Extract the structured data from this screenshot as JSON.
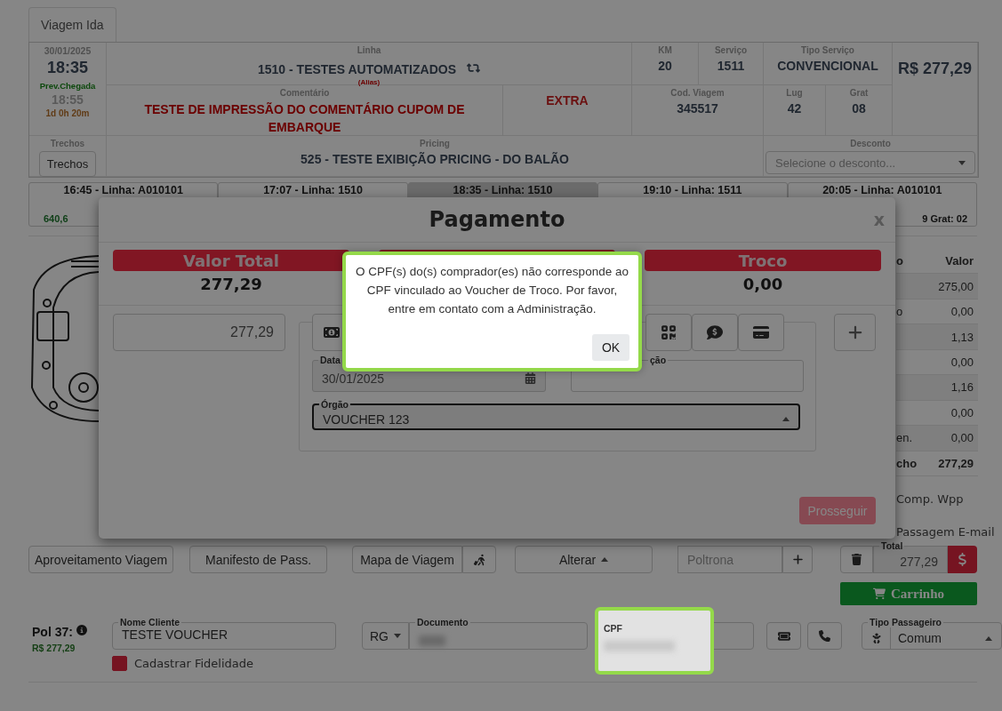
{
  "tabs": [
    {
      "label": "Viagem Ida",
      "selected": true
    }
  ],
  "trip": {
    "date": "30/01/2025",
    "departure": "18:35",
    "arrival_label": "Prev.Chegada",
    "arrival": "18:55",
    "duration": "1d 0h 20m",
    "line": {
      "label": "Linha",
      "value": "1510 - TESTES AUTOMATIZADOS",
      "alias": "(Alias)"
    },
    "km": {
      "label": "KM",
      "value": "20"
    },
    "service": {
      "label": "Serviço",
      "value": "1511"
    },
    "service_type": {
      "label": "Tipo Serviço",
      "value": "CONVENCIONAL"
    },
    "price": "R$ 277,29",
    "comment": {
      "label": "Comentário",
      "value": "TESTE DE IMPRESSÃO DO COMENTÁRIO CUPOM DE EMBARQUE"
    },
    "extra": "EXTRA",
    "trip_code": {
      "label": "Cod. Viagem",
      "value": "345517"
    },
    "seats": {
      "label": "Lug",
      "value": "42"
    },
    "free": {
      "label": "Grat",
      "value": "08"
    },
    "segments": {
      "label": "Trechos",
      "button": "Trechos"
    },
    "pricing": {
      "label": "Pricing",
      "value": "525 - TESTE EXIBIÇÃO PRICING - DO BALÃO"
    },
    "discount": {
      "label": "Desconto",
      "placeholder": "Selecione o desconto..."
    }
  },
  "schedule": [
    {
      "title": "16:45 - Linha: A010101",
      "detail": "640,6",
      "selected": false
    },
    {
      "title": "17:07 - Linha: 1510",
      "selected": false
    },
    {
      "title": "18:35 - Linha: 1510",
      "selected": true
    },
    {
      "title": "19:10 - Linha: 1511",
      "selected": false
    },
    {
      "title": "20:05 - Linha: A010101",
      "detail": "9 Grat: 02",
      "selected": false
    }
  ],
  "fare_table": {
    "header": [
      "o",
      "Valor"
    ],
    "rows": [
      {
        "kind": "line",
        "value": "275,00"
      },
      {
        "kind": "line",
        "label": "o",
        "value": "0,00"
      },
      {
        "kind": "line",
        "value": "1,13"
      },
      {
        "kind": "line",
        "value": "0,00"
      },
      {
        "kind": "line",
        "value": "1,16"
      },
      {
        "kind": "line",
        "value": "0,00"
      },
      {
        "kind": "line",
        "label": "en.",
        "value": "0,00"
      },
      {
        "kind": "total",
        "label": "cho",
        "value": "277,29"
      }
    ]
  },
  "share_options": [
    "Comp. Wpp",
    "Passagem E-mail"
  ],
  "actions": {
    "reuse": "Aproveitamento Viagem",
    "manifest": "Manifesto de Pass.",
    "map": "Mapa de Viagem",
    "change": "Alterar",
    "seat_placeholder": "Poltrona",
    "total_label": "Total",
    "total": "277,29",
    "cart": "Carrinho"
  },
  "passenger": {
    "seat": "Pol 37:",
    "price": "R$ 277,29",
    "name": {
      "label": "Nome Cliente",
      "value": "TESTE VOUCHER"
    },
    "doc_type": "RG",
    "document": {
      "label": "Documento"
    },
    "cpf": {
      "label": "CPF"
    },
    "loyalty": {
      "label": "Cadastrar Fidelidade",
      "checked": true
    },
    "passenger_type": {
      "label": "Tipo Passageiro",
      "value": "Comum"
    }
  },
  "modal": {
    "title": "Pagamento",
    "close": "x",
    "summary": [
      {
        "label": "Valor Total",
        "value": "277,29"
      },
      {
        "label": "Troco",
        "value": "0,00"
      }
    ],
    "amount": "277,29",
    "date_field": {
      "label": "Data",
      "value": "30/01/2025"
    },
    "second_field": {
      "label": "ção"
    },
    "agency": {
      "label": "Órgão",
      "value": "VOUCHER 123"
    },
    "proceed": {
      "label": "Prosseguir",
      "disabled": true
    }
  },
  "alert": {
    "message": "O CPF(s) do(s) comprador(es) não corresponde ao CPF vinculado ao Voucher de Troco. Por favor, entre em contato com a Administração.",
    "button": "OK"
  }
}
